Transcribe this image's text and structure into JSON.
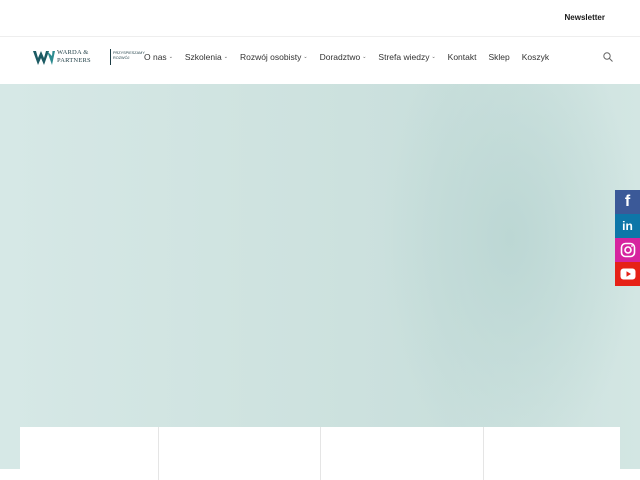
{
  "topbar": {
    "newsletter_label": "Newsletter"
  },
  "brand": {
    "name_line1": "WARDA &",
    "name_line2": "PARTNERS",
    "tagline_line1": "PRZYSPIESZAMY",
    "tagline_line2": "ROZWÓJ",
    "logo_color": "#1c5a63"
  },
  "nav": {
    "items": [
      {
        "label": "O nas",
        "has_dropdown": true
      },
      {
        "label": "Szkolenia",
        "has_dropdown": true
      },
      {
        "label": "Rozwój osobisty",
        "has_dropdown": true
      },
      {
        "label": "Doradztwo",
        "has_dropdown": true
      },
      {
        "label": "Strefa wiedzy",
        "has_dropdown": true
      },
      {
        "label": "Kontakt",
        "has_dropdown": false
      },
      {
        "label": "Sklep",
        "has_dropdown": false
      },
      {
        "label": "Koszyk",
        "has_dropdown": false
      }
    ],
    "search_icon": "search-icon"
  },
  "social": {
    "items": [
      {
        "name": "facebook-icon",
        "color": "#3b5998"
      },
      {
        "name": "linkedin-icon",
        "color": "#0e76a8"
      },
      {
        "name": "instagram-icon",
        "color": "#d6249f"
      },
      {
        "name": "youtube-icon",
        "color": "#e62117"
      }
    ]
  }
}
